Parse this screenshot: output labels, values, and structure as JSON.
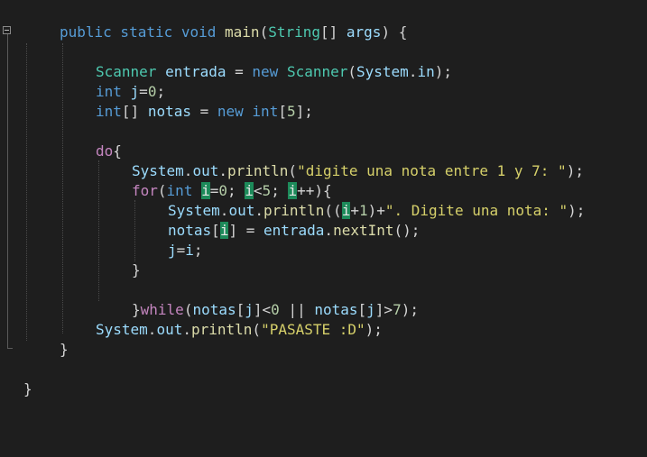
{
  "editor": {
    "lines": [
      [
        [
          "kw",
          "public static void "
        ],
        [
          "fn",
          "main"
        ],
        [
          "pl",
          "("
        ],
        [
          "ty",
          "String"
        ],
        [
          "pl",
          "[] "
        ],
        [
          "var",
          "args"
        ],
        [
          "pl",
          ") {"
        ]
      ],
      [
        [
          "ty",
          "Scanner "
        ],
        [
          "var",
          "entrada"
        ],
        [
          "pl",
          " = "
        ],
        [
          "kw",
          "new "
        ],
        [
          "ty",
          "Scanner"
        ],
        [
          "pl",
          "("
        ],
        [
          "var",
          "System"
        ],
        [
          "pl",
          "."
        ],
        [
          "var",
          "in"
        ],
        [
          "pl",
          ");"
        ]
      ],
      [
        [
          "kw",
          "int "
        ],
        [
          "var",
          "j"
        ],
        [
          "pl",
          "="
        ],
        [
          "num",
          "0"
        ],
        [
          "pl",
          ";"
        ]
      ],
      [
        [
          "kw",
          "int"
        ],
        [
          "pl",
          "[] "
        ],
        [
          "var",
          "notas"
        ],
        [
          "pl",
          " = "
        ],
        [
          "kw",
          "new int"
        ],
        [
          "pl",
          "["
        ],
        [
          "num",
          "5"
        ],
        [
          "pl",
          "];"
        ]
      ],
      [
        [
          "kw2",
          "do"
        ],
        [
          "pl",
          "{"
        ]
      ],
      [
        [
          "var",
          "System"
        ],
        [
          "pl",
          "."
        ],
        [
          "var",
          "out"
        ],
        [
          "pl",
          "."
        ],
        [
          "fn",
          "println"
        ],
        [
          "pl",
          "("
        ],
        [
          "str",
          "\"digite una nota entre 1 y 7: \""
        ],
        [
          "pl",
          ");"
        ]
      ],
      [
        [
          "kw2",
          "for"
        ],
        [
          "pl",
          "("
        ],
        [
          "kw",
          "int "
        ],
        [
          "hl",
          "i"
        ],
        [
          "pl",
          "="
        ],
        [
          "num",
          "0"
        ],
        [
          "pl",
          "; "
        ],
        [
          "hl",
          "i"
        ],
        [
          "pl",
          "<"
        ],
        [
          "num",
          "5"
        ],
        [
          "pl",
          "; "
        ],
        [
          "hl",
          "i"
        ],
        [
          "pl",
          "++){"
        ]
      ],
      [
        [
          "var",
          "System"
        ],
        [
          "pl",
          "."
        ],
        [
          "var",
          "out"
        ],
        [
          "pl",
          "."
        ],
        [
          "fn",
          "println"
        ],
        [
          "pl",
          "(("
        ],
        [
          "hl",
          "i"
        ],
        [
          "pl",
          "+"
        ],
        [
          "num",
          "1"
        ],
        [
          "pl",
          ")+"
        ],
        [
          "str",
          "\". Digite una nota: \""
        ],
        [
          "pl",
          ");"
        ]
      ],
      [
        [
          "var",
          "notas"
        ],
        [
          "pl",
          "["
        ],
        [
          "hl",
          "i"
        ],
        [
          "pl",
          "] = "
        ],
        [
          "var",
          "entrada"
        ],
        [
          "pl",
          "."
        ],
        [
          "fn",
          "nextInt"
        ],
        [
          "pl",
          "();"
        ]
      ],
      [
        [
          "var",
          "j"
        ],
        [
          "pl",
          "="
        ],
        [
          "var",
          "i"
        ],
        [
          "pl",
          ";"
        ]
      ],
      [
        [
          "pl",
          "}"
        ]
      ],
      [
        [
          "pl",
          "}"
        ],
        [
          "kw2",
          "while"
        ],
        [
          "pl",
          "("
        ],
        [
          "var",
          "notas"
        ],
        [
          "pl",
          "["
        ],
        [
          "var",
          "j"
        ],
        [
          "pl",
          "]<"
        ],
        [
          "num",
          "0"
        ],
        [
          "pl",
          " || "
        ],
        [
          "var",
          "notas"
        ],
        [
          "pl",
          "["
        ],
        [
          "var",
          "j"
        ],
        [
          "pl",
          "]>"
        ],
        [
          "num",
          "7"
        ],
        [
          "pl",
          ");"
        ]
      ],
      [
        [
          "var",
          "System"
        ],
        [
          "pl",
          "."
        ],
        [
          "var",
          "out"
        ],
        [
          "pl",
          "."
        ],
        [
          "fn",
          "println"
        ],
        [
          "pl",
          "("
        ],
        [
          "str",
          "\"PASASTE :D\""
        ],
        [
          "pl",
          ");"
        ]
      ],
      [
        [
          "pl",
          "}"
        ]
      ],
      [
        [
          "pl",
          "}"
        ]
      ]
    ]
  }
}
